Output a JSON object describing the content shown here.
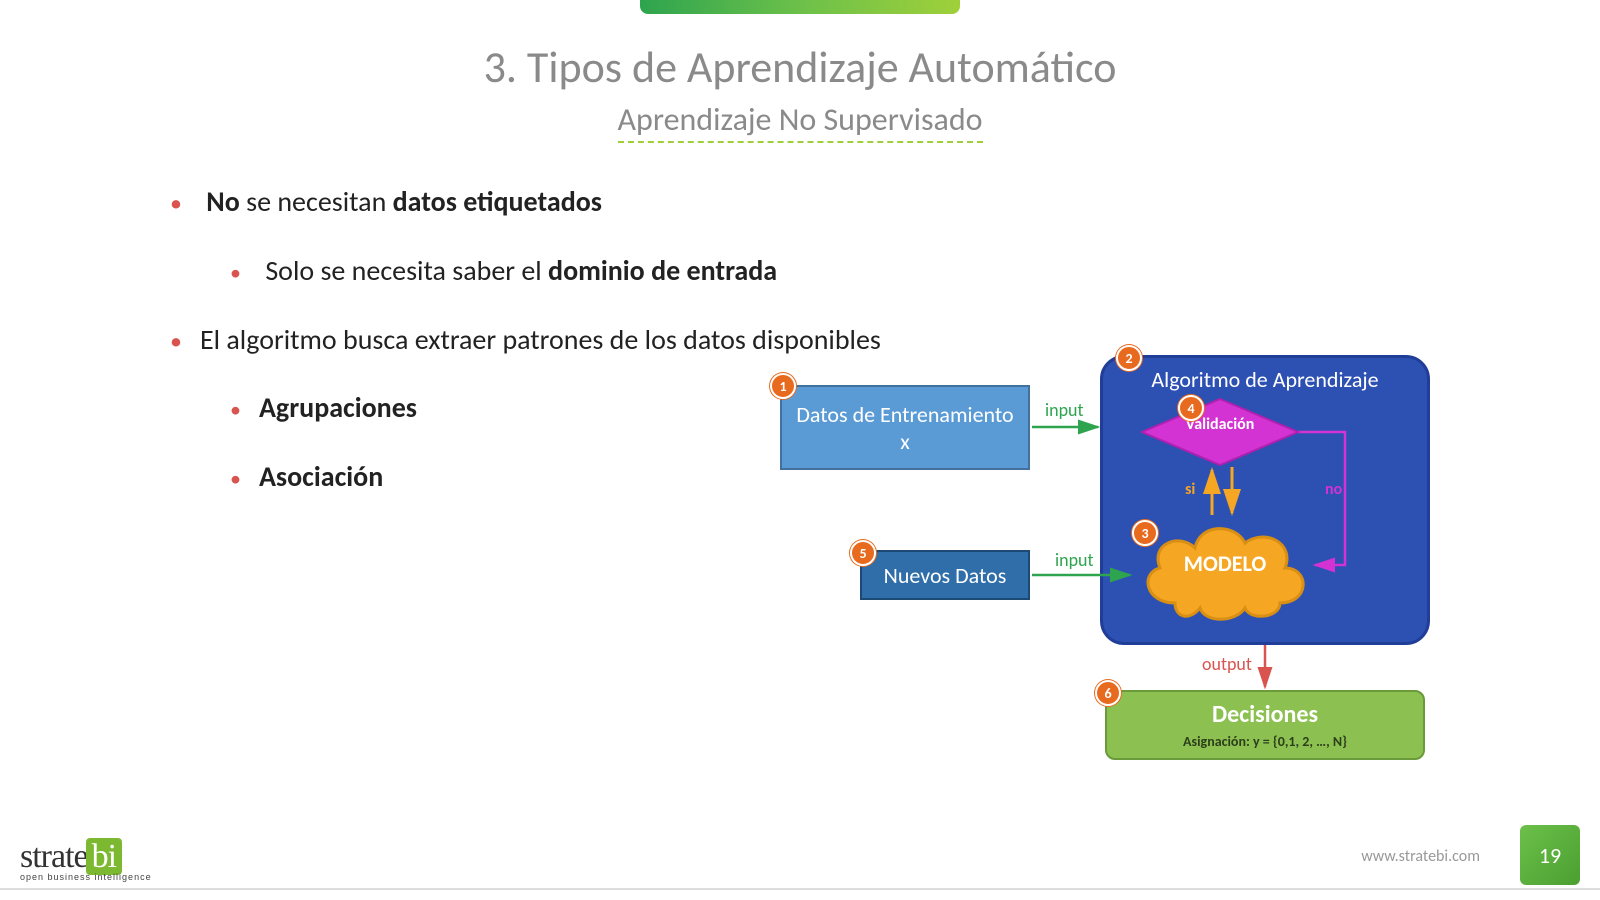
{
  "title": "3. Tipos de Aprendizaje Automático",
  "subtitle": "Aprendizaje No Supervisado",
  "bullets": {
    "b1_pre": "No",
    "b1_mid": " se necesitan ",
    "b1_post": "datos etiquetados",
    "b1a_pre": "Solo se necesita saber el ",
    "b1a_post": "dominio de entrada",
    "b2": "El algoritmo busca extraer patrones de los datos disponibles",
    "b2a": "Agrupaciones",
    "b2b": "Asociación"
  },
  "diagram": {
    "train_l1": "Datos de Entrenamiento",
    "train_l2": "x",
    "algo_title": "Algoritmo de Aprendizaje",
    "validation": "Validación",
    "modelo": "MODELO",
    "newdata": "Nuevos Datos",
    "decisiones": "Decisiones",
    "asignacion": "Asignación: y = {0,1, 2, …, N}",
    "input1": "input",
    "input2": "input",
    "output": "output",
    "si": "si",
    "no": "no",
    "badges": {
      "b1": "1",
      "b2": "2",
      "b3": "3",
      "b4": "4",
      "b5": "5",
      "b6": "6"
    }
  },
  "footer": {
    "brand_a": "strate",
    "brand_b": "bi",
    "tagline": "open business intelligence",
    "url": "www.stratebi.com",
    "page": "19"
  }
}
